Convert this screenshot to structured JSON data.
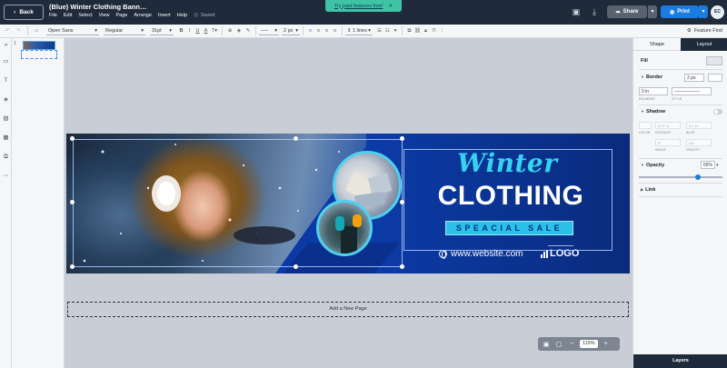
{
  "header": {
    "back_label": "Back",
    "doc_title": "(Blue) Winter Clothing Bann…",
    "menu": [
      "File",
      "Edit",
      "Select",
      "View",
      "Page",
      "Arrange",
      "Insert",
      "Help"
    ],
    "saved_label": "Saved",
    "promo_label": "Try paid features free!",
    "share_label": "Share",
    "print_label": "Print",
    "avatar_initials": "EC"
  },
  "toolbar": {
    "font_family": "Open Sans",
    "font_weight": "Regular",
    "font_size": "31pt",
    "line_width": "2 px",
    "line_spacing": "1 lines",
    "feature_find": "Feature Find"
  },
  "pages_panel": {
    "page_number": "1"
  },
  "banner": {
    "title_script": "Winter",
    "title_main": "CLOTHING",
    "sale_label": "SPEACIAL SALE",
    "website": "www.website.com",
    "logo_text": "LOGO"
  },
  "canvas": {
    "add_page_label": "Add a New Page",
    "zoom_value": "115%"
  },
  "right_panel": {
    "tabs": [
      "Shape",
      "Layout"
    ],
    "fill_label": "Fill",
    "border_label": "Border",
    "border_width": "2 px",
    "rounded_value": "0 in",
    "rounded_label": "ROUNDED",
    "style_label": "STYLE",
    "shadow_label": "Shadow",
    "shadow_fields": [
      "COLOR",
      "DISTANCE",
      "BLUR",
      "ANGLE",
      "OPACITY"
    ],
    "shadow_values": [
      "0.07 in",
      "0.1 in",
      "0°",
      "0%"
    ],
    "opacity_label": "Opacity",
    "opacity_value": "65%",
    "link_label": "Link",
    "layers_label": "Layers"
  },
  "colors": {
    "topbar": "#1f2b3a",
    "accent": "#1a7be0",
    "promo": "#3fc3a5",
    "banner_blue": "#0b3ba6",
    "banner_cyan": "#36d3f1"
  }
}
